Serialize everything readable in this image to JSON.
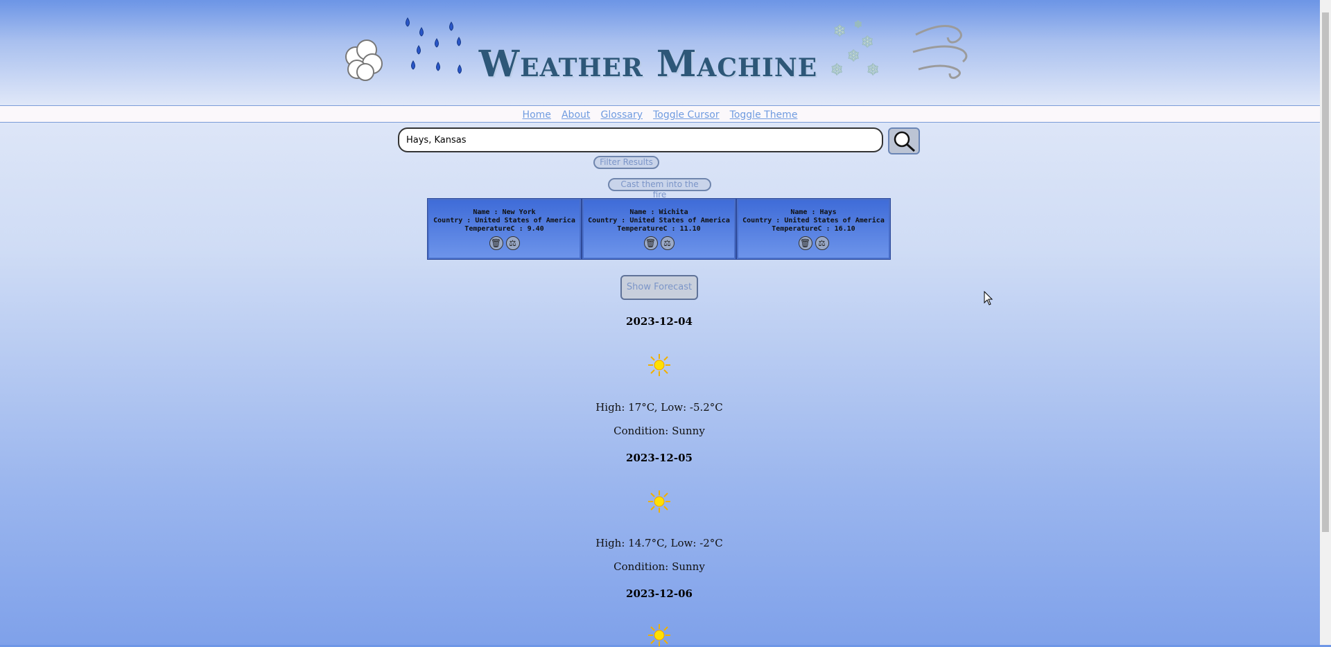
{
  "header": {
    "title": "Weather Machine"
  },
  "nav": [
    {
      "label": "Home"
    },
    {
      "label": "About"
    },
    {
      "label": "Glossary"
    },
    {
      "label": "Toggle Cursor"
    },
    {
      "label": "Toggle Theme"
    }
  ],
  "search": {
    "value": "Hays, Kansas"
  },
  "buttons": {
    "filter": "Filter Results",
    "cast": "Cast them into the fire",
    "forecast": "Show Forecast"
  },
  "cards": [
    {
      "name": "Name : New York",
      "country": "Country : United States of America",
      "temp": "TemperatureC : 9.40"
    },
    {
      "name": "Name : Wichita",
      "country": "Country : United States of America",
      "temp": "TemperatureC : 11.10"
    },
    {
      "name": "Name : Hays",
      "country": "Country : United States of America",
      "temp": "TemperatureC : 16.10"
    }
  ],
  "forecast": [
    {
      "date": "2023-12-04",
      "hilo": "High: 17°C, Low: -5.2°C",
      "condition": "Condition: Sunny",
      "icon": "sun-icon"
    },
    {
      "date": "2023-12-05",
      "hilo": "High: 14.7°C, Low: -2°C",
      "condition": "Condition: Sunny",
      "icon": "sun-icon"
    },
    {
      "date": "2023-12-06",
      "icon": "sun-icon"
    }
  ],
  "colors": {
    "accent": "#2d5778",
    "link": "#6f9be0",
    "card": "#3f6cd8"
  }
}
